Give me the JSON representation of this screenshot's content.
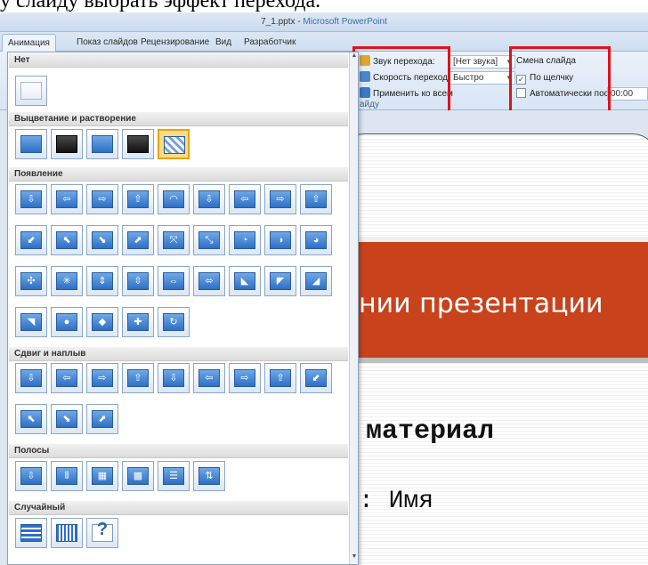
{
  "caption": "у слайду выбрать эффект перехода.",
  "window": {
    "file": "7_1.pptx",
    "separator": " - ",
    "app": "Microsoft PowerPoint"
  },
  "tabs": [
    "Анимация",
    "Показ слайдов",
    "Рецензирование",
    "Вид",
    "Разработчик"
  ],
  "active_tab": 0,
  "ribbon": {
    "sound_label": "Звук перехода:",
    "sound_value": "[Нет звука]",
    "speed_label": "Скорость перехода:",
    "speed_value": "Быстро",
    "apply_all_label": "Применить ко всем",
    "group_label_fragment": "айду",
    "advance_group": "Смена слайда",
    "on_click_label": "По щелчку",
    "on_click_checked": true,
    "auto_after_label": "Автоматически после:",
    "auto_after_value": "00:00",
    "auto_after_checked": false
  },
  "gallery": {
    "sections": [
      {
        "title": "Нет",
        "items": [
          "none"
        ]
      },
      {
        "title": "Выцветание и растворение",
        "items": [
          "fade-smoothly",
          "fade-through-black",
          "cut",
          "cut-through-black",
          "dissolve"
        ]
      },
      {
        "title": "Появление",
        "items": [
          "wipe-down",
          "wipe-left",
          "wipe-right",
          "wipe-up",
          "wedge",
          "uncover-down",
          "uncover-left",
          "uncover-right",
          "uncover-up",
          "uncover-left-down",
          "uncover-left-up",
          "uncover-right-down",
          "uncover-right-up",
          "box-in",
          "box-out",
          "wheel-1",
          "wheel-2",
          "wheel-3",
          "wheel-4",
          "wheel-8",
          "split-horizontal-in",
          "split-horizontal-out",
          "split-vertical-in",
          "split-vertical-out",
          "strips-left-down",
          "strips-left-up",
          "strips-right-down",
          "strips-right-up",
          "circle",
          "diamond",
          "plus",
          "newsflash"
        ]
      },
      {
        "title": "Сдвиг и наплыв",
        "items": [
          "push-down",
          "push-left",
          "push-right",
          "push-up",
          "cover-down",
          "cover-left",
          "cover-right",
          "cover-up",
          "cover-left-down",
          "cover-left-up",
          "cover-right-down",
          "cover-right-up"
        ]
      },
      {
        "title": "Полосы",
        "items": [
          "blinds-horizontal",
          "blinds-vertical",
          "checkerboard-across",
          "checkerboard-down",
          "comb-horizontal",
          "comb-vertical"
        ]
      },
      {
        "title": "Случайный",
        "items": [
          "random-bars-horizontal",
          "random-bars-vertical",
          "random-transition"
        ]
      }
    ],
    "selected": "dissolve"
  },
  "slide": {
    "title_fragment": "нии презентации",
    "subtitle_fragment": "материал",
    "name_fragment": ": Имя"
  },
  "colors": {
    "highlight": "#e0121b",
    "slide_band": "#c8421c",
    "thumb_blue": "#2e6fc6"
  }
}
